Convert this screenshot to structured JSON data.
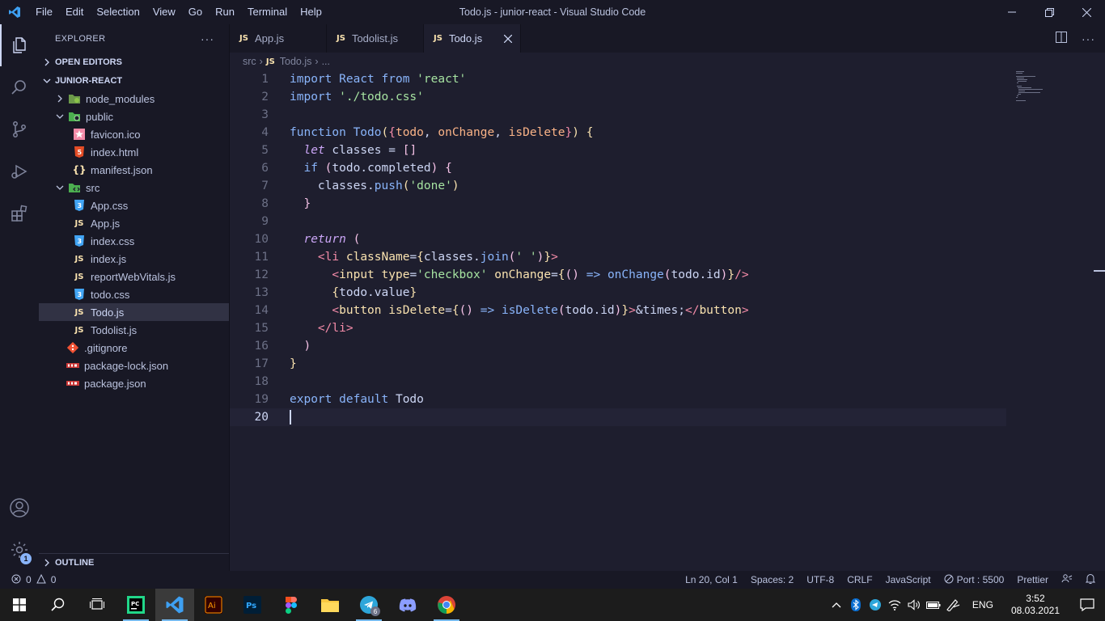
{
  "window": {
    "title": "Todo.js - junior-react - Visual Studio Code",
    "menu": [
      "File",
      "Edit",
      "Selection",
      "View",
      "Go",
      "Run",
      "Terminal",
      "Help"
    ]
  },
  "sidebar": {
    "header": "EXPLORER",
    "more": "···",
    "open_editors": "OPEN EDITORS",
    "project": "JUNIOR-REACT",
    "tree": [
      {
        "name": "node_modules",
        "type": "folder-closed",
        "icon": "node-folder-icon"
      },
      {
        "name": "public",
        "type": "folder-open",
        "icon": "public-folder-icon"
      },
      {
        "name": "favicon.ico",
        "type": "file",
        "icon": "favicon-icon"
      },
      {
        "name": "index.html",
        "type": "file",
        "icon": "html-icon"
      },
      {
        "name": "manifest.json",
        "type": "file",
        "icon": "json-icon"
      },
      {
        "name": "src",
        "type": "folder-open",
        "icon": "src-folder-icon"
      },
      {
        "name": "App.css",
        "type": "file",
        "icon": "css-icon"
      },
      {
        "name": "App.js",
        "type": "file",
        "icon": "js-icon"
      },
      {
        "name": "index.css",
        "type": "file",
        "icon": "css-icon"
      },
      {
        "name": "index.js",
        "type": "file",
        "icon": "js-icon"
      },
      {
        "name": "reportWebVitals.js",
        "type": "file",
        "icon": "js-icon"
      },
      {
        "name": "todo.css",
        "type": "file",
        "icon": "css-icon"
      },
      {
        "name": "Todo.js",
        "type": "file",
        "icon": "js-icon",
        "selected": true
      },
      {
        "name": "Todolist.js",
        "type": "file",
        "icon": "js-icon"
      },
      {
        "name": ".gitignore",
        "type": "file",
        "icon": "git-icon"
      },
      {
        "name": "package-lock.json",
        "type": "file",
        "icon": "npm-icon"
      },
      {
        "name": "package.json",
        "type": "file",
        "icon": "npm-icon"
      }
    ],
    "outline": "OUTLINE"
  },
  "tabs": [
    {
      "label": "App.js",
      "badge": "JS"
    },
    {
      "label": "Todolist.js",
      "badge": "JS"
    },
    {
      "label": "Todo.js",
      "badge": "JS",
      "active": true
    }
  ],
  "breadcrumb": {
    "folder": "src",
    "badge": "JS",
    "file": "Todo.js",
    "more": "..."
  },
  "editor": {
    "line_numbers": [
      "1",
      "2",
      "3",
      "4",
      "5",
      "6",
      "7",
      "8",
      "9",
      "10",
      "11",
      "12",
      "13",
      "14",
      "15",
      "16",
      "17",
      "18",
      "19",
      "20"
    ],
    "current_line": 20
  },
  "status": {
    "errors": "0",
    "warnings": "0",
    "position": "Ln 20, Col 1",
    "spaces": "Spaces: 2",
    "encoding": "UTF-8",
    "eol": "CRLF",
    "language": "JavaScript",
    "port": "Port : 5500",
    "formatter": "Prettier"
  },
  "settings_badge": "1",
  "taskbar": {
    "language": "ENG",
    "time": "3:52",
    "date": "08.03.2021",
    "telegram_badge": "6"
  },
  "colors": {
    "bg": "#1e1e2e",
    "sidebar": "#181825",
    "accent": "#89b4fa",
    "js_badge": "#f9e2af"
  }
}
